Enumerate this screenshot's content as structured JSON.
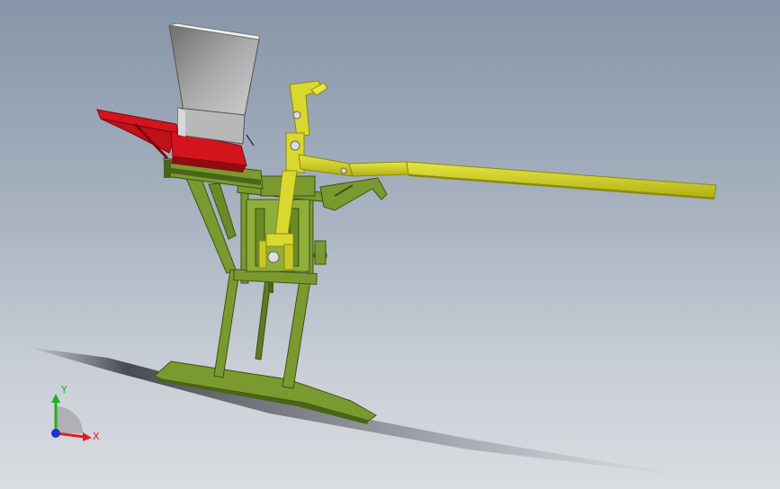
{
  "viewport": {
    "triad": {
      "x_label": "X",
      "y_label": "Y",
      "x_color": "#e02020",
      "y_color": "#20b020",
      "z_color": "#2030d0"
    }
  },
  "colors": {
    "frame": "#7a9a30",
    "frame_dark": "#4a6418",
    "hopper": "#8c8c8c",
    "hopper_light": "#d9d9d9",
    "chute": "#d4141c",
    "lever": "#d8d830",
    "lever_dark": "#8a8a10"
  }
}
